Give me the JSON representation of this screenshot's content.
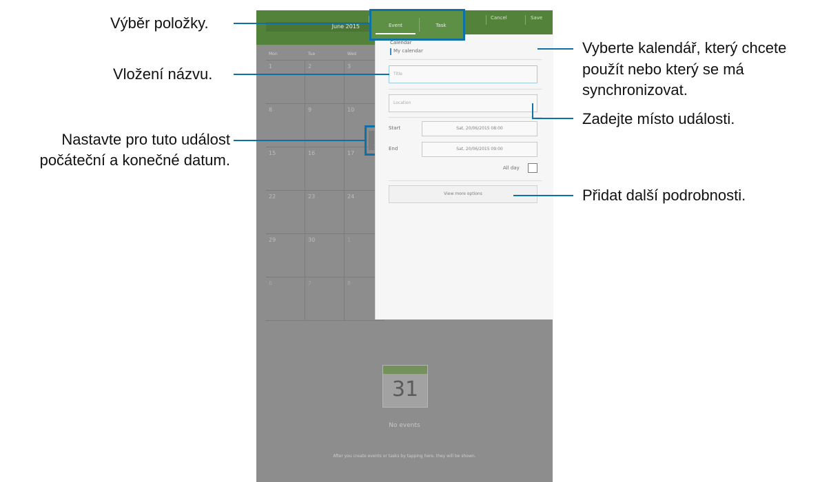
{
  "screen": {
    "top_tabs": [
      "Event",
      "Task"
    ],
    "top_actions": [
      "Cancel",
      "Save"
    ],
    "month_label": "June 2015",
    "weekdays": [
      "Mon",
      "Tue",
      "Wed"
    ],
    "calendar_rows": [
      [
        "1",
        "2",
        "3"
      ],
      [
        "8",
        "9",
        "10"
      ],
      [
        "15",
        "16",
        "17"
      ],
      [
        "22",
        "23",
        "24"
      ],
      [
        "29",
        "30",
        "1"
      ],
      [
        "6",
        "7",
        "8"
      ]
    ],
    "panel": {
      "calendar_label": "Calendar",
      "calendar_value": "My calendar",
      "title_placeholder": "Title",
      "location_placeholder": "Location",
      "start_label": "Start",
      "start_value": "Sat, 20/06/2015  08:00",
      "end_label": "End",
      "end_value": "Sat, 20/06/2015  09:00",
      "all_day_label": "All day",
      "view_more_label": "View more options"
    },
    "day_number": "31",
    "no_events_label": "No events",
    "no_events_desc": "After you create events or tasks by tapping here, they will be shown."
  },
  "annotations": {
    "select_item": "Výběr položky.",
    "insert_title": "Vložení názvu.",
    "set_dates_line1": "Nastavte pro tuto událost",
    "set_dates_line2": "počáteční a konečné datum.",
    "calendar_line1": "Vyberte kalendář, který chcete",
    "calendar_line2": "použít nebo který se má",
    "calendar_line3": "synchronizovat.",
    "location": "Zadejte místo události.",
    "more_details": "Přidat další podrobnosti."
  },
  "colors": {
    "accent_blue": "#0d71a8",
    "header_green": "#53823b"
  }
}
